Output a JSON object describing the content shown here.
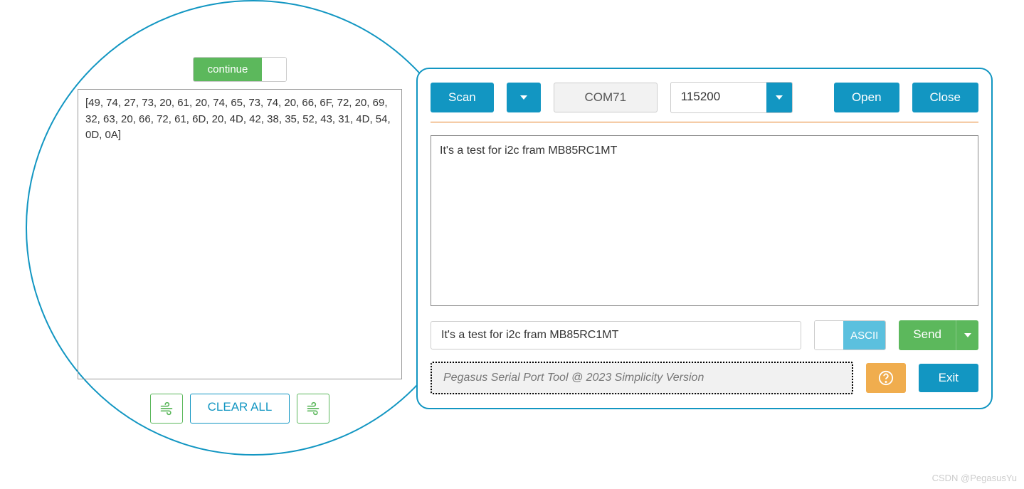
{
  "left": {
    "continue_label": "continue",
    "hex_output": "[49, 74, 27, 73, 20, 61, 20, 74, 65, 73, 74, 20, 66, 6F, 72, 20, 69, 32, 63, 20, 66, 72, 61, 6D, 20, 4D, 42, 38, 35, 52, 43, 31, 4D, 54, 0D, 0A]",
    "clear_all_label": "CLEAR ALL"
  },
  "toolbar": {
    "scan_label": "Scan",
    "port_label": "COM71",
    "baud_label": "115200",
    "open_label": "Open",
    "close_label": "Close"
  },
  "terminal": {
    "output_text": "It's a test for i2c fram MB85RC1MT",
    "input_value": "It's a test for i2c fram MB85RC1MT",
    "mode_label": "ASCII",
    "send_label": "Send",
    "footer_text": "Pegasus Serial Port Tool @ 2023 Simplicity Version",
    "exit_label": "Exit"
  },
  "watermark": "CSDN @PegasusYu"
}
